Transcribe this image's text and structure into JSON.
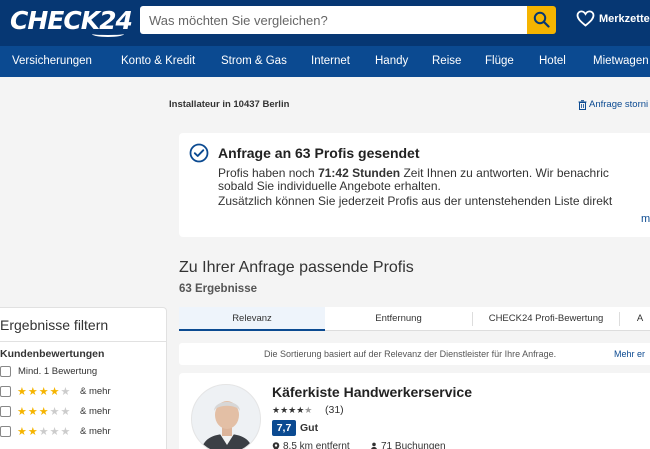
{
  "header": {
    "logo": "CHECK24",
    "search_placeholder": "Was möchten Sie vergleichen?",
    "merkzettel": "Merkzettel",
    "colors": {
      "bar": "#063773",
      "search_button": "#f5b400"
    }
  },
  "nav": {
    "items": [
      "Versicherungen",
      "Konto & Kredit",
      "Strom & Gas",
      "Internet",
      "Handy",
      "Reise",
      "Flüge",
      "Hotel",
      "Mietwagen"
    ]
  },
  "breadcrumb": "Installateur in 10437 Berlin",
  "storno_link": "Anfrage storni",
  "confirmation": {
    "title": "Anfrage an 63 Profis gesendet",
    "line1_prefix": "Profis haben noch ",
    "line1_bold": "71:42 Stunden",
    "line1_suffix": " Zeit Ihnen zu antworten. Wir benachric",
    "line2": "sobald Sie individuelle Angebote erhalten.",
    "line3": "Zusätzlich können Sie jederzeit Profis aus der untenstehenden Liste direkt",
    "more": "m"
  },
  "results": {
    "heading": "Zu Ihrer Anfrage passende Profis",
    "count": "63 Ergebnisse"
  },
  "filter": {
    "title": "Ergebnisse filtern",
    "section": "Kundenbewertungen",
    "options": [
      {
        "label": "Mind. 1 Bewertung",
        "stars": 0
      },
      {
        "label": "& mehr",
        "stars": 4
      },
      {
        "label": "& mehr",
        "stars": 3
      },
      {
        "label": "& mehr",
        "stars": 2
      }
    ]
  },
  "tabs": [
    "Relevanz",
    "Entfernung",
    "CHECK24 Profi-Bewertung",
    "A"
  ],
  "sort_note": {
    "text": "Die Sortierung basiert auf der Relevanz der Dienstleister für Ihre Anfrage.",
    "link": "Mehr er"
  },
  "result_card": {
    "name": "Käferkiste Handwerkerservice",
    "rating_stars": 4.5,
    "rating_count": "(31)",
    "score": "7,7",
    "score_label": "Gut",
    "distance": "8,5 km entfernt",
    "bookings": "71 Buchungen"
  }
}
